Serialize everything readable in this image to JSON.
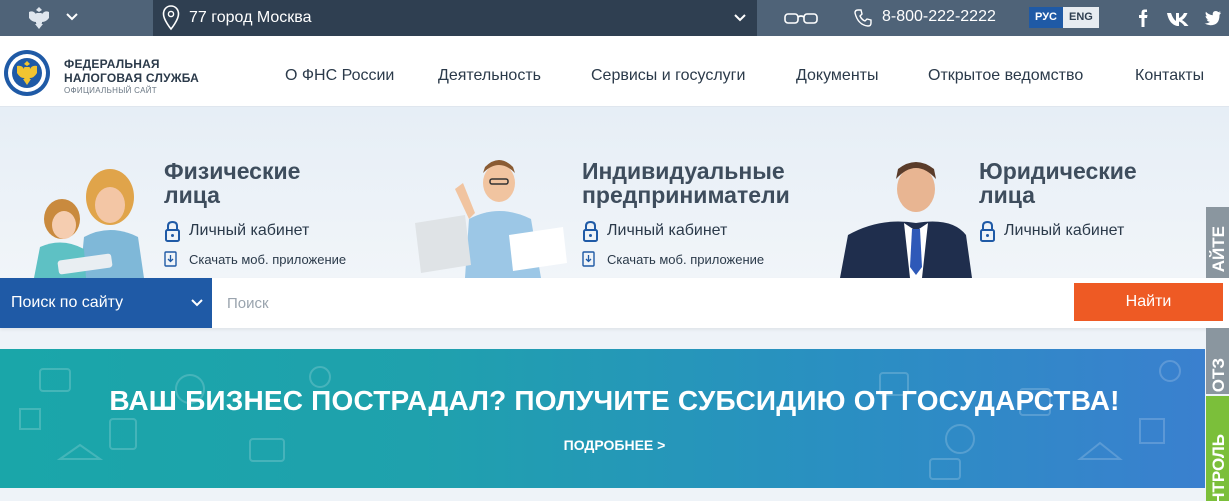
{
  "topbar": {
    "region": "77 город Москва",
    "phone": "8-800-222-2222",
    "lang_ru": "РУС",
    "lang_en": "ENG",
    "icons": [
      "emblem-icon",
      "chevron-down-icon",
      "location-pin-icon",
      "glasses-icon",
      "phone-icon",
      "facebook-icon",
      "vk-icon",
      "twitter-icon"
    ]
  },
  "header": {
    "logo_line1": "ФЕДЕРАЛЬНАЯ",
    "logo_line2": "НАЛОГОВАЯ СЛУЖБА",
    "logo_line3": "ОФИЦИАЛЬНЫЙ САЙТ",
    "nav": [
      {
        "label": "О ФНС России"
      },
      {
        "label": "Деятельность"
      },
      {
        "label": "Сервисы и госуслуги"
      },
      {
        "label": "Документы"
      },
      {
        "label": "Открытое ведомство"
      },
      {
        "label": "Контакты"
      }
    ]
  },
  "hero": {
    "categories": [
      {
        "title1": "Физические",
        "title2": "лица",
        "cabinet": "Личный кабинет",
        "app": "Скачать моб. приложение"
      },
      {
        "title1": "Индивидуальные",
        "title2": "предприниматели",
        "cabinet": "Личный кабинет",
        "app": "Скачать моб. приложение"
      },
      {
        "title1": "Юридические",
        "title2": "лица",
        "cabinet": "Личный кабинет"
      }
    ]
  },
  "search": {
    "scope": "Поиск по сайту",
    "placeholder": "Поиск",
    "button": "Найти"
  },
  "banner": {
    "title": "ВАШ БИЗНЕС ПОСТРАДАЛ? ПОЛУЧИТЕ СУБСИДИЮ ОТ ГОСУДАРСТВА!",
    "more": "ПОДРОБНЕЕ >"
  },
  "side_tabs": {
    "tab1": "АЙТЕ",
    "tab2": "ОТЗ",
    "tab3": "НТРОЛЬ"
  },
  "colors": {
    "topbar": "#4f6378",
    "region_bg": "#2f3f51",
    "accent_blue": "#1f5aa6",
    "button_orange": "#ee5a24",
    "banner_teal": "#1aa6a9",
    "tab_green": "#7bbf3a"
  }
}
